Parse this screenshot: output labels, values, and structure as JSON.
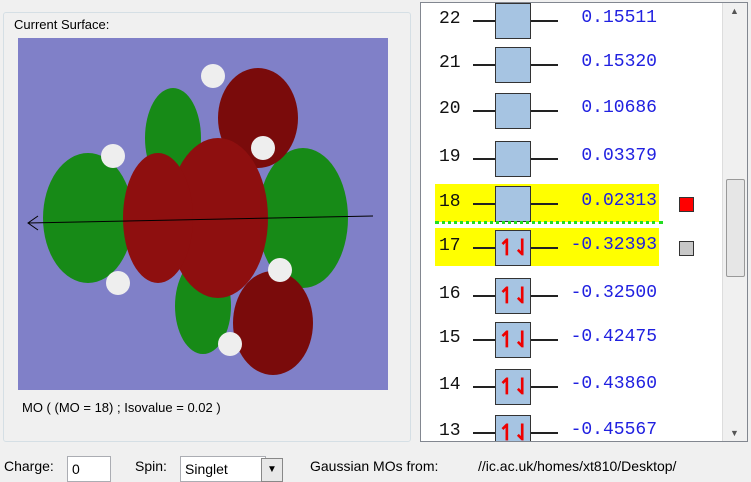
{
  "surface_panel": {
    "title": "Current Surface:",
    "caption": "MO ( (MO = 18) ; Isovalue = 0.02 )"
  },
  "orbitals": [
    {
      "n": "22",
      "energy": "0.15511",
      "occupied": false
    },
    {
      "n": "21",
      "energy": "0.15320",
      "occupied": false
    },
    {
      "n": "20",
      "energy": "0.10686",
      "occupied": false
    },
    {
      "n": "19",
      "energy": "0.03379",
      "occupied": false
    },
    {
      "n": "18",
      "energy": "0.02313",
      "occupied": false,
      "highlight": true,
      "marker": "#ff0000"
    },
    {
      "n": "17",
      "energy": "-0.32393",
      "occupied": true,
      "highlight": true,
      "marker": "#c8c8c8"
    },
    {
      "n": "16",
      "energy": "-0.32500",
      "occupied": true
    },
    {
      "n": "15",
      "energy": "-0.42475",
      "occupied": true
    },
    {
      "n": "14",
      "energy": "-0.43860",
      "occupied": true
    },
    {
      "n": "13",
      "energy": "-0.45567",
      "occupied": true
    }
  ],
  "bottom": {
    "charge_label": "Charge:",
    "charge_value": "0",
    "spin_label": "Spin:",
    "spin_value": "Singlet",
    "source_label": "Gaussian MOs from:",
    "source_path": "//ic.ac.uk/homes/xt810/Desktop/"
  },
  "colors": {
    "background": "#8080c8",
    "positive_lobe": "#8b0000",
    "negative_lobe": "#1a8a1a",
    "highlight": "#ffff00"
  }
}
